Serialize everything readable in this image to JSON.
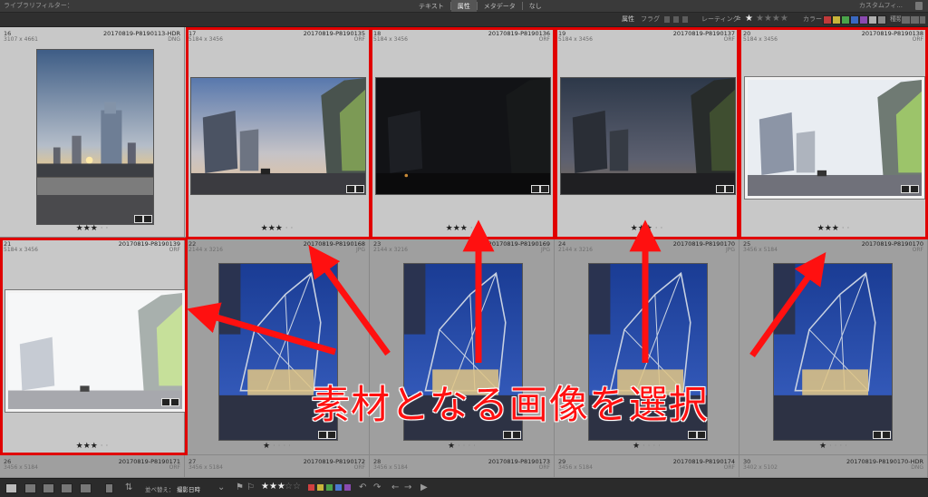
{
  "topbar": {
    "library_filter": "ライブラリフィルター：",
    "tabs": [
      {
        "label": "テキスト"
      },
      {
        "label": "属性",
        "active": true
      },
      {
        "label": "メタデータ"
      },
      {
        "label": "なし"
      }
    ],
    "custom_filter": "カスタムフィ..."
  },
  "filterbar": {
    "attribute_label": "属性",
    "flag_label": "フラグ",
    "rating_label": "レーティング",
    "rating_op": "≥",
    "color_label": "カラー",
    "kind_label": "種類",
    "color_swatches": [
      "#c03a3a",
      "#c8b43a",
      "#4aa34a",
      "#3a68c0",
      "#8a4ab0",
      "#b0b0b0",
      "#888888"
    ]
  },
  "photos": [
    {
      "num": "16",
      "name": "20170819-P8190113-HDR",
      "dims": "3107 x 4661",
      "ext": "DNG",
      "rating": 3,
      "highlighted": false,
      "selected": true,
      "scene": "sunset-portrait"
    },
    {
      "num": "17",
      "name": "20170819-P8190135",
      "dims": "5184 x 3456",
      "ext": "ORF",
      "rating": 3,
      "highlighted": true,
      "selected": true,
      "scene": "city-dusk"
    },
    {
      "num": "18",
      "name": "20170819-P8190136",
      "dims": "5184 x 3456",
      "ext": "ORF",
      "rating": 3,
      "highlighted": true,
      "selected": true,
      "scene": "city-dark"
    },
    {
      "num": "19",
      "name": "20170819-P8190137",
      "dims": "5184 x 3456",
      "ext": "ORF",
      "rating": 3,
      "highlighted": true,
      "selected": true,
      "scene": "city-dim"
    },
    {
      "num": "20",
      "name": "20170819-P8190138",
      "dims": "5184 x 3456",
      "ext": "ORF",
      "rating": 3,
      "highlighted": true,
      "selected": true,
      "scene": "city-bright"
    },
    {
      "num": "21",
      "name": "20170819-P8190139",
      "dims": "5184 x 3456",
      "ext": "ORF",
      "rating": 3,
      "highlighted": true,
      "selected": true,
      "scene": "city-overexposed"
    },
    {
      "num": "22",
      "name": "20170819-P8190168",
      "dims": "2144 x 3216",
      "ext": "JPG",
      "rating": 1,
      "highlighted": false,
      "selected": false,
      "scene": "glass-night"
    },
    {
      "num": "23",
      "name": "20170819-P8190169",
      "dims": "2144 x 3216",
      "ext": "JPG",
      "rating": 1,
      "highlighted": false,
      "selected": false,
      "scene": "glass-night"
    },
    {
      "num": "24",
      "name": "20170819-P8190170",
      "dims": "2144 x 3216",
      "ext": "JPG",
      "rating": 1,
      "highlighted": false,
      "selected": false,
      "scene": "glass-night"
    },
    {
      "num": "25",
      "name": "20170819-P8190170",
      "dims": "3456 x 5184",
      "ext": "ORF",
      "rating": 1,
      "highlighted": false,
      "selected": false,
      "scene": "glass-night"
    },
    {
      "num": "26",
      "name": "20170819-P8190171",
      "dims": "3456 x 5184",
      "ext": "ORF",
      "rating": 0,
      "highlighted": false,
      "selected": false,
      "scene": "none"
    },
    {
      "num": "27",
      "name": "20170819-P8190172",
      "dims": "3456 x 5184",
      "ext": "ORF",
      "rating": 0,
      "highlighted": false,
      "selected": false,
      "scene": "none"
    },
    {
      "num": "28",
      "name": "20170819-P8190173",
      "dims": "3456 x 5184",
      "ext": "ORF",
      "rating": 0,
      "highlighted": false,
      "selected": false,
      "scene": "none"
    },
    {
      "num": "29",
      "name": "20170819-P8190174",
      "dims": "3456 x 5184",
      "ext": "ORF",
      "rating": 0,
      "highlighted": false,
      "selected": false,
      "scene": "none"
    },
    {
      "num": "30",
      "name": "20170819-P8190170-HDR",
      "dims": "3402 x 5102",
      "ext": "DNG",
      "rating": 0,
      "highlighted": false,
      "selected": false,
      "scene": "none"
    }
  ],
  "annotation": {
    "caption": "素材となる画像を選択",
    "color": "#ff1010"
  },
  "bottombar": {
    "sort_label": "並べ替え：",
    "sort_value": "撮影日時",
    "rating_filter_stars": "★★★",
    "rating_filter_dim": "☆☆",
    "label_colors": [
      "#d04040",
      "#c8b43a",
      "#4aa34a",
      "#4a78d0",
      "#8a4ab0"
    ]
  }
}
